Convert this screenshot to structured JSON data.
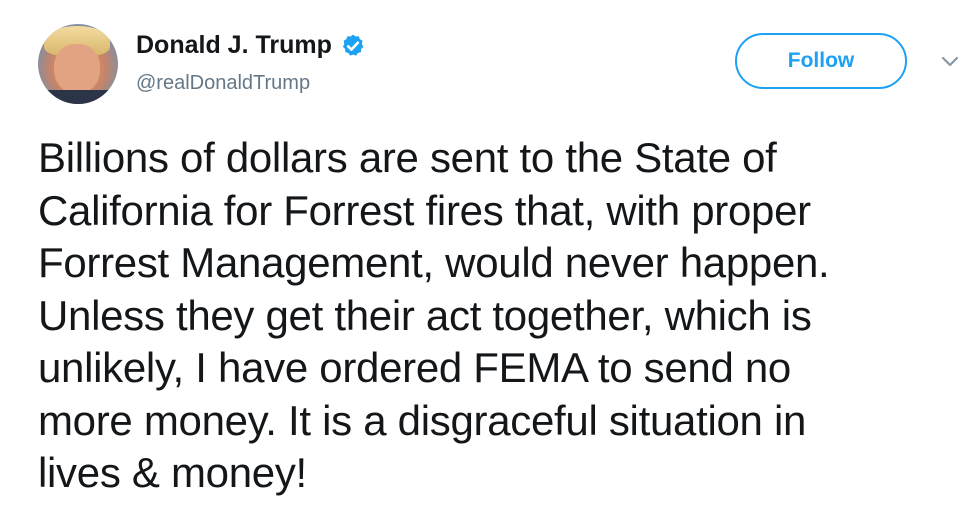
{
  "author": {
    "display_name": "Donald J. Trump",
    "handle": "@realDonaldTrump",
    "verified": true,
    "avatar_icon": "profile-photo"
  },
  "actions": {
    "follow_label": "Follow",
    "more_icon": "chevron-down-icon"
  },
  "tweet": {
    "text": "Billions of dollars are sent to the State of\nCalifornia for Forrest fires that, with proper\nForrest Management, would never happen.\nUnless they get their act together, which is\nunlikely, I have ordered FEMA to send no\nmore money. It is a disgraceful situation in\nlives & money!"
  },
  "colors": {
    "accent": "#1da1f2",
    "text": "#14171a",
    "secondary_text": "#657786"
  }
}
